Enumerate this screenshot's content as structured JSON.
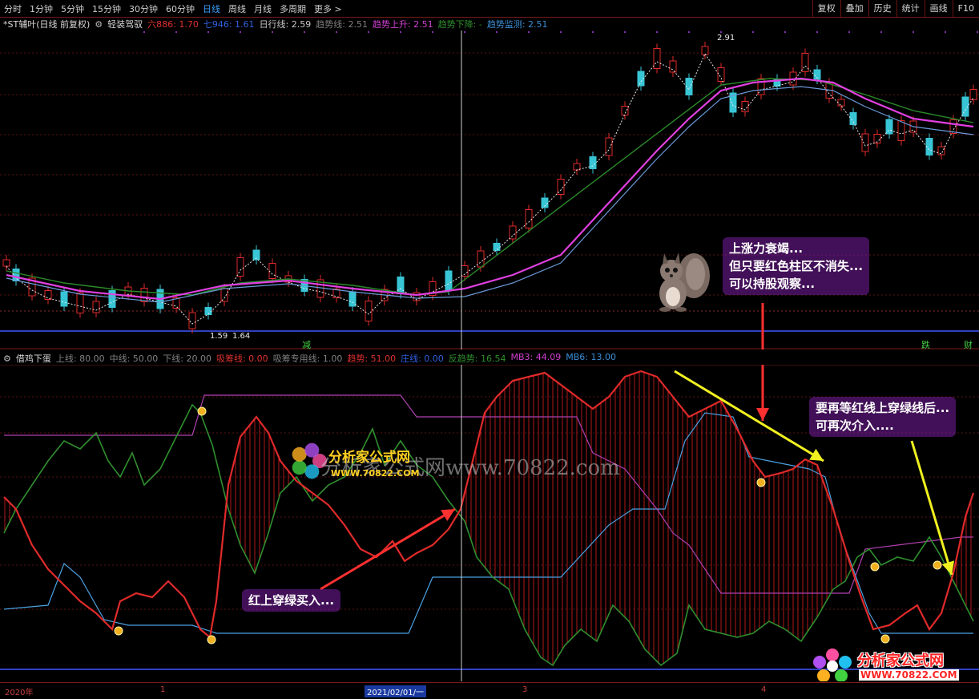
{
  "toolbar": {
    "periods": [
      "分时",
      "1分钟",
      "5分钟",
      "15分钟",
      "30分钟",
      "60分钟",
      "日线",
      "周线",
      "月线",
      "多周期",
      "更多 >"
    ],
    "active_period": "日线",
    "right_buttons": [
      "复权",
      "叠加",
      "历史",
      "统计",
      "画线",
      "F10"
    ]
  },
  "main_chart": {
    "stock_name": "*ST辅叶(日线 前复权)",
    "indicator_name": "轻装驾驭",
    "items": [
      {
        "text": "六886: 1.70",
        "color": "#e03030"
      },
      {
        "text": "七946: 1.61",
        "color": "#3060e0"
      },
      {
        "text": "日行线: 2.59",
        "color": "#c8c8c8"
      },
      {
        "text": "趋势线: 2.51",
        "color": "#808080"
      },
      {
        "text": "趋势上升: 2.51",
        "color": "#d040d0"
      },
      {
        "text": "趋势下降: -",
        "color": "#2f8f2f"
      },
      {
        "text": "趋势监测: 2.51",
        "color": "#3a8fd8"
      }
    ],
    "high_label": "2.91",
    "low_label": "1.59",
    "low_label2": "1.64",
    "marker_reduce": "减",
    "marker_fall": "跌",
    "marker_sell": "财"
  },
  "sub_chart": {
    "indicator_name": "借鸡下蛋",
    "items": [
      {
        "text": "上线: 80.00",
        "color": "#808080"
      },
      {
        "text": "中线: 50.00",
        "color": "#808080"
      },
      {
        "text": "下线: 20.00",
        "color": "#808080"
      },
      {
        "text": "吸筹线: 0.00",
        "color": "#e03030"
      },
      {
        "text": "吸筹专用线: 1.00",
        "color": "#808080"
      },
      {
        "text": "趋势: 51.00",
        "color": "#e03030"
      },
      {
        "text": "庄线: 0.00",
        "color": "#3060e0"
      },
      {
        "text": "反趋势: 16.54",
        "color": "#2f8f2f"
      },
      {
        "text": "MB3: 44.09",
        "color": "#d040d0"
      },
      {
        "text": "MB6: 13.00",
        "color": "#3a8fd8"
      }
    ],
    "watermark": "分析家公式网www.70822.com",
    "watermark_logo": "分析家公式网",
    "watermark_url": "WWW.70822.COM"
  },
  "annotations": {
    "buy": "红上穿绿买入...",
    "hold_1": "上涨力衰竭...",
    "hold_2": "但只要红色柱区不消失...",
    "hold_3": "可以持股观察...",
    "reentry_1": "要再等红线上穿绿线后...",
    "reentry_2": "可再次介入...."
  },
  "time_axis": {
    "labels": [
      "2020年",
      "1",
      "2021/02/01/一",
      "3",
      "4"
    ],
    "selected": "2021/02/01/一"
  },
  "logo": {
    "name": "分析家公式网",
    "url": "WWW.70822.COM"
  },
  "colors": {
    "up_candle": "#e02a2a",
    "down_candle": "#38c6d6",
    "ma_fast": "#e040e0",
    "ma_slow": "#6a9ad8",
    "ma_green": "#2a8a2a",
    "trend_red": "#e02a2a",
    "trend_green": "#2f8f2f",
    "line_blue": "#4aa0e0",
    "line_purple": "#b040b0",
    "arrow_red": "#ff3030",
    "arrow_yellow": "#f0f020"
  }
}
